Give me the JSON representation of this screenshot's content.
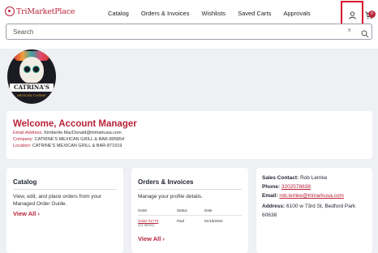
{
  "header": {
    "brand": "TriMarketPlace",
    "nav": [
      "Catalog",
      "Orders & Invoices",
      "Wishlists",
      "Saved Carts",
      "Approvals"
    ],
    "cart_count": "0"
  },
  "search": {
    "placeholder": "Search",
    "clear": "x"
  },
  "customer_logo": {
    "name": "CATRINA'S",
    "subtitle": "MEXICAN CUISINE"
  },
  "welcome": {
    "title": "Welcome, Account Manager",
    "email_label": "Email Address:",
    "email_value": "Kimberlie.MacDonald@trimarkusa.com",
    "company_label": "Company:",
    "company_value": "CATRINE'S MEXICAN GRILL & BAR-895854",
    "location_label": "Location:",
    "location_value": "CATRINE'S MEXICAN GRILL & BAR-871919"
  },
  "catalog_card": {
    "title": "Catalog",
    "description": "View, edit, and place orders from your Managed Order Guide.",
    "link": "View All  ›"
  },
  "orders_card": {
    "title": "Orders & Invoices",
    "description": "Manage your profile details.",
    "columns": [
      "Order",
      "Status",
      "Date"
    ],
    "rows": [
      {
        "order": "Order #1770",
        "items": "(13 items)",
        "status": "Paid",
        "date": "01/19/2023"
      }
    ],
    "link": "View All  ›"
  },
  "contact_card": {
    "sales_label": "Sales Contact:",
    "sales_value": "Rob Lemke",
    "phone_label": "Phone:",
    "phone_value": "3202578838",
    "email_label": "Email:",
    "email_value": "rob.lemke@trimarkusa.com",
    "address_label": "Address:",
    "address_value": "6100 w 73rd St, Bedford Park 60638"
  },
  "colors": {
    "accent": "#b8233a",
    "highlight_border": "#d8102d",
    "background": "#eef0f3"
  },
  "icons": [
    "account-icon",
    "cart-icon",
    "search-icon",
    "clear-icon"
  ]
}
